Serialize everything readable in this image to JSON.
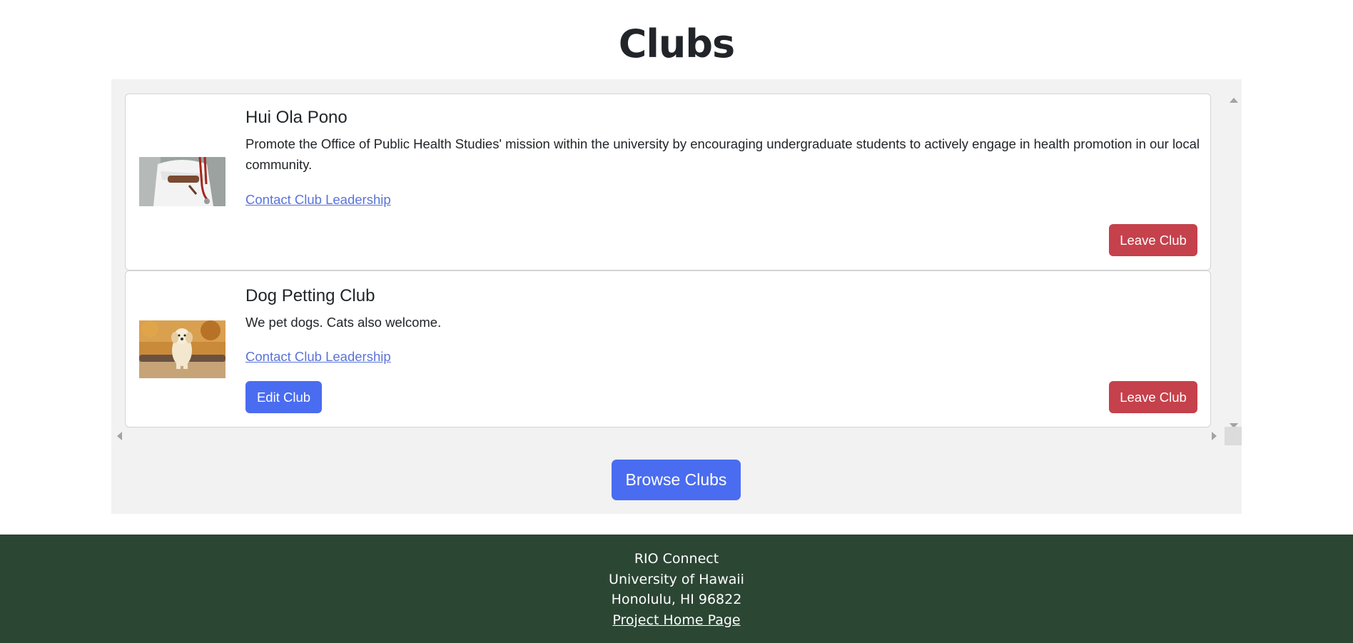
{
  "page": {
    "title": "Clubs"
  },
  "clubs": [
    {
      "name": "Hui Ola Pono",
      "description": "Promote the Office of Public Health Studies' mission within the university by encouraging undergraduate students to actively engage in health promotion in our local community.",
      "contact_label": "Contact Club Leadership",
      "leave_label": "Leave Club",
      "image": "doctor-with-stethoscope-photo"
    },
    {
      "name": "Dog Petting Club",
      "description": "We pet dogs. Cats also welcome.",
      "contact_label": "Contact Club Leadership",
      "edit_label": "Edit Club",
      "leave_label": "Leave Club",
      "image": "golden-retriever-photo"
    }
  ],
  "actions": {
    "browse_label": "Browse Clubs"
  },
  "footer": {
    "line1": "RIO Connect",
    "line2": "University of Hawaii",
    "line3": "Honolulu, HI 96822",
    "link_label": "Project Home Page"
  },
  "colors": {
    "primary": "#4a6cf0",
    "danger": "#c5414b",
    "footer_bg": "#2c4634",
    "link": "#5a73d8"
  }
}
